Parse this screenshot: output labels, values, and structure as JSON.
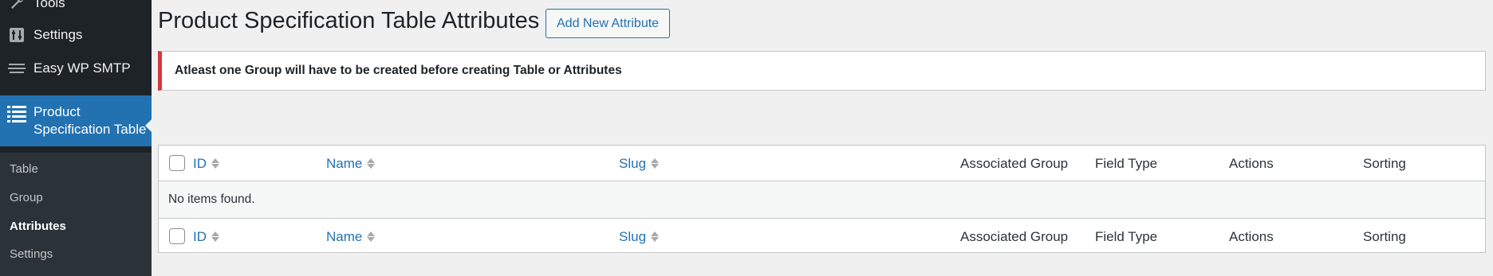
{
  "sidebar": {
    "items": [
      {
        "label": "Tools",
        "icon": "wrench-icon"
      },
      {
        "label": "Settings",
        "icon": "settings-icon"
      },
      {
        "label": "Easy WP SMTP",
        "icon": "mail-stack-icon"
      },
      {
        "label_line1": "Product",
        "label_line2": "Specification Table",
        "icon": "list-icon",
        "active": true
      }
    ],
    "submenu": [
      {
        "label": "Table"
      },
      {
        "label": "Group"
      },
      {
        "label": "Attributes",
        "current": true
      },
      {
        "label": "Settings"
      }
    ]
  },
  "page": {
    "title": "Product Specification Table Attributes",
    "add_button": "Add New Attribute",
    "notice": "Atleast one Group will have to be created before creating Table or Attributes"
  },
  "table": {
    "columns": [
      "ID",
      "Name",
      "Slug",
      "Associated Group",
      "Field Type",
      "Actions",
      "Sorting"
    ],
    "sortable": [
      "ID",
      "Name",
      "Slug"
    ],
    "empty_message": "No items found."
  },
  "colors": {
    "sidebar_bg": "#1d2327",
    "accent": "#2271b1",
    "notice_error": "#d63638"
  }
}
